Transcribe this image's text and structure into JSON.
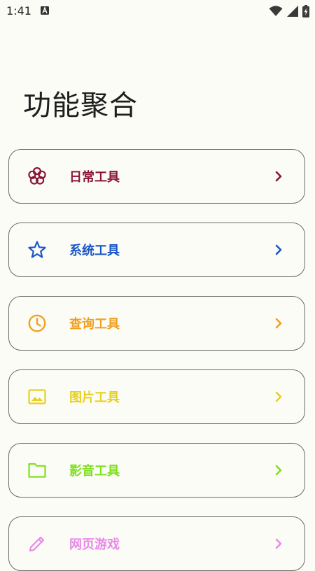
{
  "status_bar": {
    "time": "1:41"
  },
  "title": "功能聚合",
  "items": [
    {
      "label": "日常工具",
      "icon": "flower-icon",
      "color": "#8b1538"
    },
    {
      "label": "系统工具",
      "icon": "star-icon",
      "color": "#1a56c8"
    },
    {
      "label": "查询工具",
      "icon": "clock-icon",
      "color": "#f0a020"
    },
    {
      "label": "图片工具",
      "icon": "image-icon",
      "color": "#e8d020"
    },
    {
      "label": "影音工具",
      "icon": "folder-icon",
      "color": "#7ee01e"
    },
    {
      "label": "网页游戏",
      "icon": "pencil-icon",
      "color": "#e88ae8"
    }
  ]
}
